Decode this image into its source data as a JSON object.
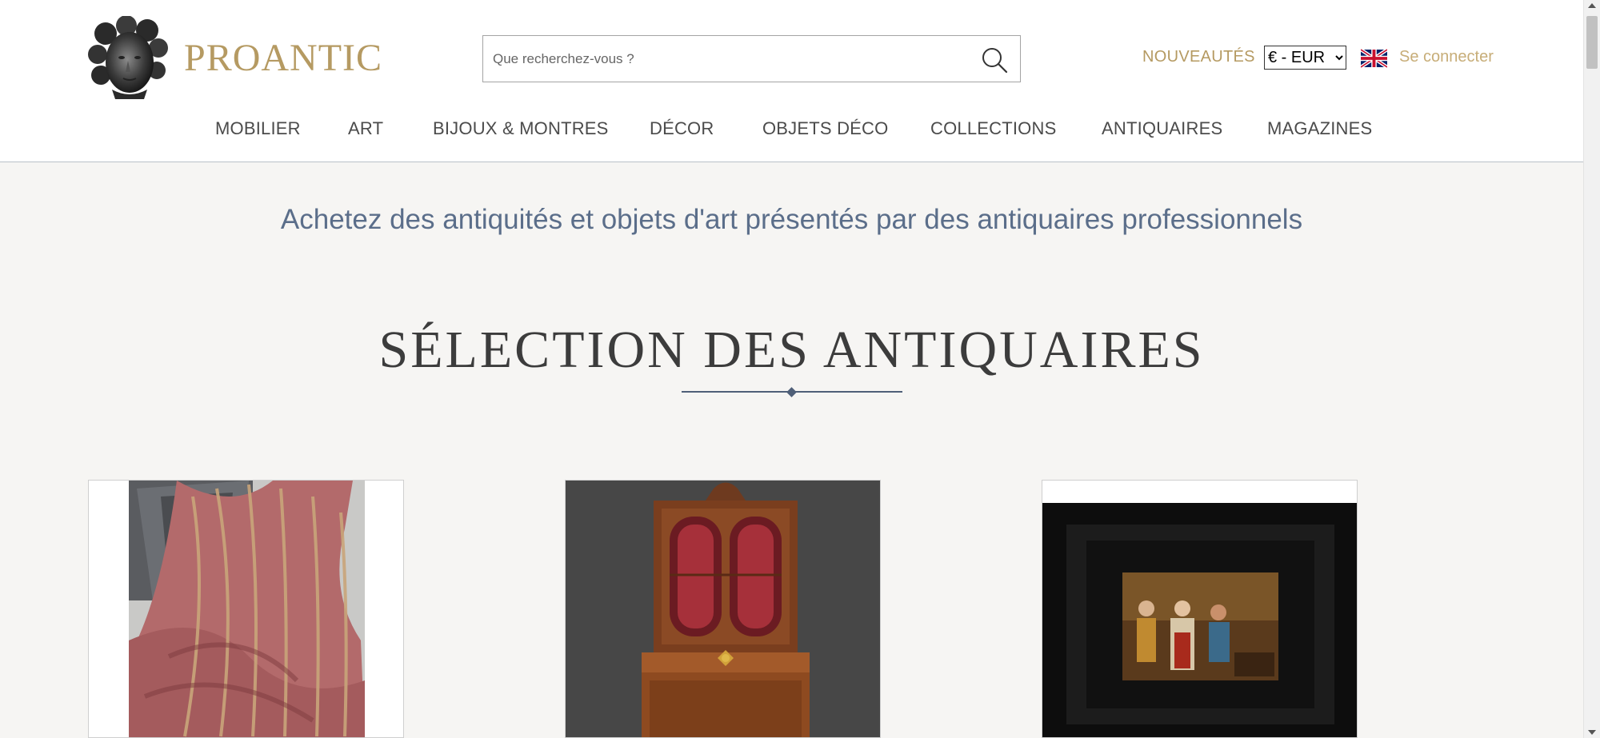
{
  "brand": {
    "name": "PROANTIC",
    "color": "#b59a62"
  },
  "search": {
    "placeholder": "Que recherchez-vous ?",
    "icon": "search-icon"
  },
  "header_links": {
    "new_label": "NOUVEAUTÉS",
    "currency_selected": "€ - EUR",
    "language_icon": "uk-flag-icon",
    "login_label": "Se connecter"
  },
  "nav": {
    "items": [
      {
        "label": "MOBILIER"
      },
      {
        "label": "ART"
      },
      {
        "label": "BIJOUX & MONTRES"
      },
      {
        "label": "DÉCOR"
      },
      {
        "label": "OBJETS DÉCO"
      },
      {
        "label": "COLLECTIONS"
      },
      {
        "label": "ANTIQUAIRES"
      },
      {
        "label": "MAGAZINES"
      }
    ]
  },
  "tagline": "Achetez des antiquités et objets d'art présentés par des antiquaires professionnels",
  "section": {
    "title": "SÉLECTION DES ANTIQUAIRES"
  },
  "products": [
    {
      "image": "red-striped-silk-fabric"
    },
    {
      "image": "walnut-secretary-bookcase"
    },
    {
      "image": "framed-genre-painting"
    }
  ]
}
